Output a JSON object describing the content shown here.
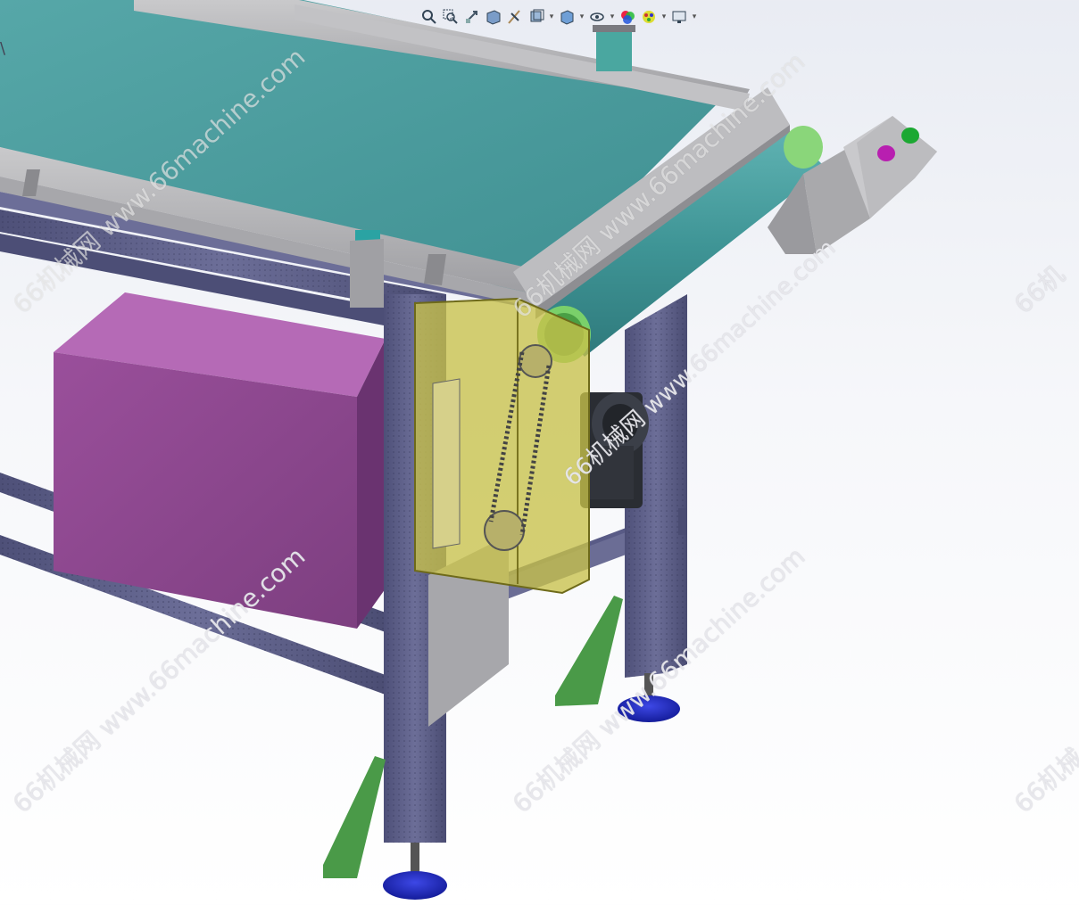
{
  "watermarks": [
    "66机械网 www.66machine.com",
    "66机械网 www.66machine.com",
    "66机械网 www.66machine.com",
    "66机械网 www.66machine.com",
    "66机械网 www.66machine.com",
    "66机",
    "66机械"
  ],
  "edge_glyph": "\\",
  "toolbar": {
    "buttons": [
      {
        "name": "zoom-to-fit-icon"
      },
      {
        "name": "zoom-to-area-icon"
      },
      {
        "name": "previous-view-icon"
      },
      {
        "name": "section-view-icon"
      },
      {
        "name": "dynamic-annotation-icon"
      },
      {
        "name": "view-orientation-icon",
        "dropdown": true
      },
      {
        "name": "display-style-icon",
        "dropdown": true
      },
      {
        "name": "hide-show-items-icon",
        "dropdown": true
      },
      {
        "name": "edit-appearance-icon"
      },
      {
        "name": "apply-scene-icon",
        "dropdown": true
      },
      {
        "name": "view-settings-icon",
        "dropdown": true
      }
    ]
  },
  "colors": {
    "belt": "#4f9f9f",
    "frame": "#5d5f8a",
    "sheet_metal": "#b5b5b7",
    "electrical_box": "#8b4a8c",
    "guard": "#c8c24a",
    "feet": "#1d26b8",
    "brackets": "#4a9a48",
    "button_green": "#1ca832",
    "button_magenta": "#b81fb0"
  }
}
